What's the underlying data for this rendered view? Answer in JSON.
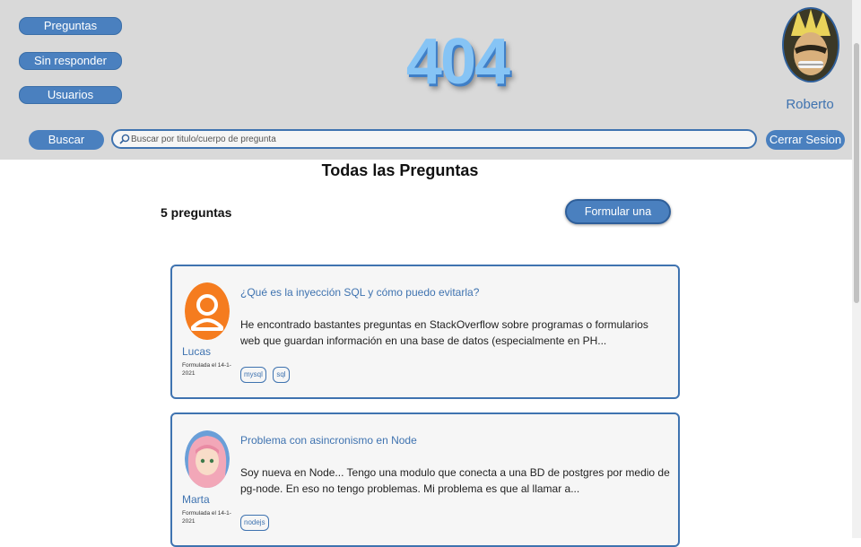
{
  "nav": {
    "preguntas": "Preguntas",
    "sin_responder": "Sin responder",
    "usuarios": "Usuarios"
  },
  "logo": "404",
  "user": {
    "name": "Roberto"
  },
  "search": {
    "button": "Buscar",
    "placeholder": "Buscar por titulo/cuerpo de pregunta",
    "value": ""
  },
  "logout": "Cerrar Sesion",
  "main": {
    "title": "Todas las Preguntas",
    "count": "5 preguntas",
    "ask_button": "Formular una pregunta"
  },
  "questions": [
    {
      "author": "Lucas",
      "date": "Formulada el 14-1-2021",
      "title": "¿Qué es la inyección SQL y cómo puedo evitarla?",
      "body": "He encontrado bastantes preguntas en StackOverflow sobre programas o formularios web que guardan información en una base de datos (especialmente en PH...",
      "tags": [
        "mysql",
        "sql"
      ],
      "avatar_color": "#f57c1f"
    },
    {
      "author": "Marta",
      "date": "Formulada el 14-1-2021",
      "title": "Problema con asincronismo en Node",
      "body": "Soy nueva en Node... Tengo una modulo que conecta a una BD de postgres por medio de pg-node. En eso no tengo problemas. Mi problema es que al llamar a...",
      "tags": [
        "nodejs"
      ],
      "avatar_color": "#f2a7b8"
    }
  ],
  "colors": {
    "accent": "#4a80bf",
    "header_bg": "#d9d9d9",
    "link": "#3f73b0"
  }
}
